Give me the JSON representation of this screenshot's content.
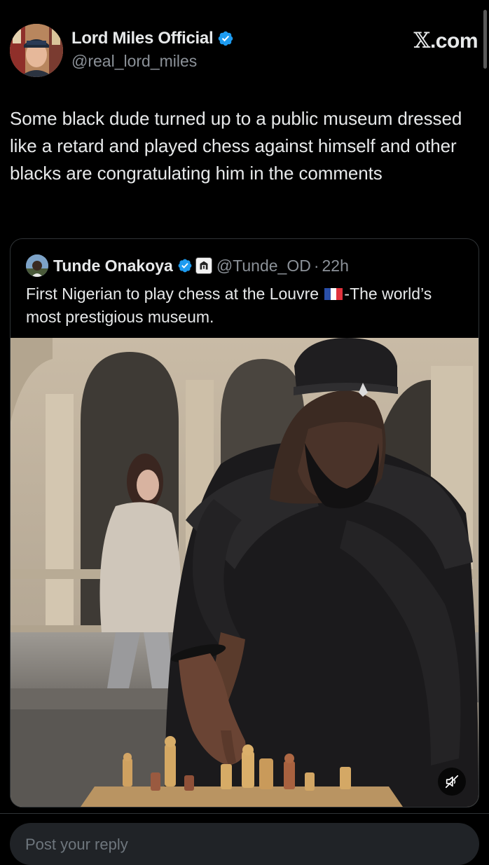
{
  "post": {
    "author": {
      "display_name": "Lord Miles Official",
      "handle": "@real_lord_miles",
      "verified": true
    },
    "source_label": "X.com",
    "text": "Some black dude turned up to a public museum dressed like a retard and played chess against himself and other blacks are congratulating him in the comments"
  },
  "quote": {
    "author": {
      "display_name": "Tunde Onakoya",
      "handle": "@Tunde_OD",
      "verified": true,
      "affiliation_badge": "org-badge-icon"
    },
    "separator": "·",
    "time": "22h",
    "text_before_flag": "First Nigerian to play chess at the Louvre ",
    "flag": "france-flag-icon",
    "text_after_flag": "-The world’s most prestigious museum.",
    "media": {
      "type": "video",
      "muted": true,
      "mute_icon": "speaker-muted-icon"
    }
  },
  "reply": {
    "placeholder": "Post your reply"
  },
  "colors": {
    "background": "#000000",
    "text_primary": "#e7e9ea",
    "text_secondary": "#8b9198",
    "border": "#2f3336",
    "verified_blue": "#1d9bf0",
    "reply_box": "#202327"
  }
}
